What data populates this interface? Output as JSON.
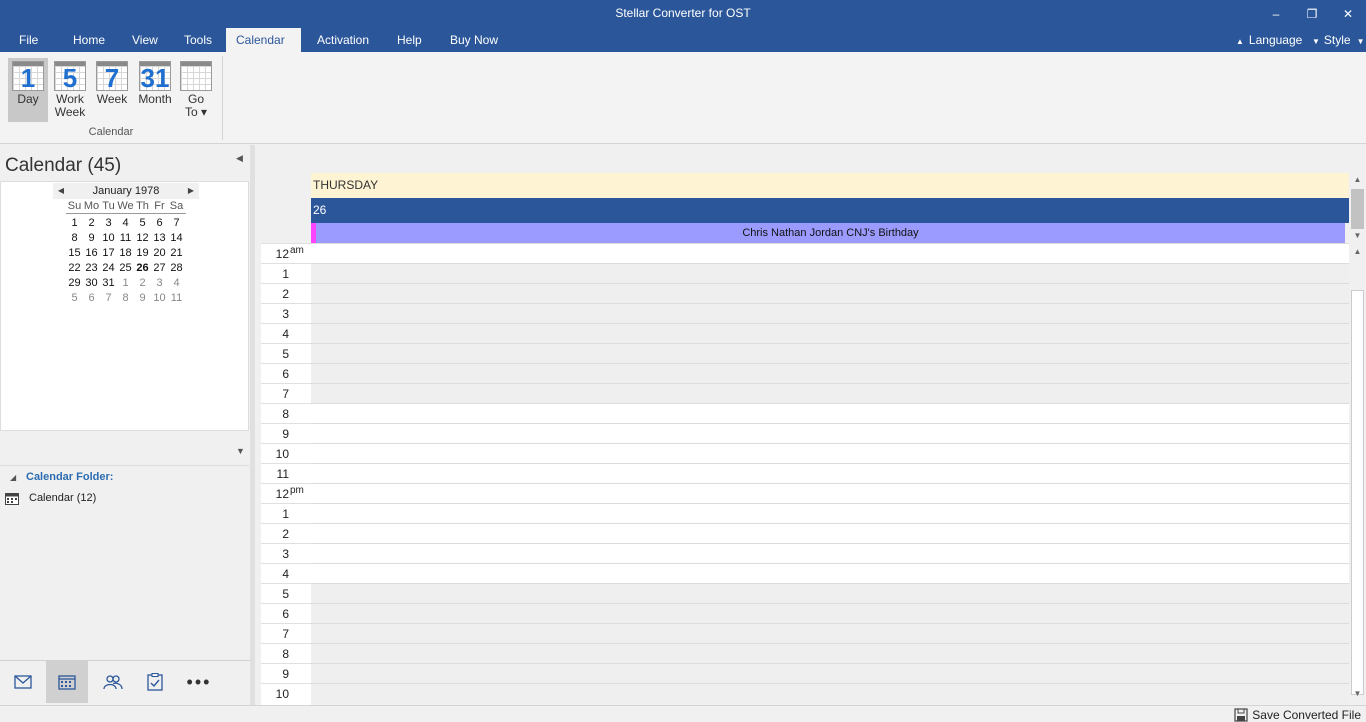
{
  "app": {
    "title": "Stellar Converter for OST"
  },
  "menu": {
    "items": [
      "File",
      "Home",
      "View",
      "Tools",
      "Calendar",
      "Activation",
      "Help",
      "Buy Now"
    ],
    "active": "Calendar",
    "language": "Language",
    "style": "Style"
  },
  "ribbon": {
    "buttons": [
      {
        "num": "1",
        "label": "Day"
      },
      {
        "num": "5",
        "label": "Work",
        "label2": "Week"
      },
      {
        "num": "7",
        "label": "Week"
      },
      {
        "num": "31",
        "label": "Month"
      },
      {
        "num": "",
        "label": "Go",
        "label2": "To ▾"
      }
    ],
    "group_label": "Calendar"
  },
  "left": {
    "title": "Calendar (45)",
    "minical": {
      "month": "January 1978",
      "days": [
        "Su",
        "Mo",
        "Tu",
        "We",
        "Th",
        "Fr",
        "Sa"
      ],
      "weeks": [
        [
          "1",
          "2",
          "3",
          "4",
          "5",
          "6",
          "7"
        ],
        [
          "8",
          "9",
          "10",
          "11",
          "12",
          "13",
          "14"
        ],
        [
          "15",
          "16",
          "17",
          "18",
          "19",
          "20",
          "21"
        ],
        [
          "22",
          "23",
          "24",
          "25",
          "26",
          "27",
          "28"
        ],
        [
          "29",
          "30",
          "31",
          "1",
          "2",
          "3",
          "4"
        ],
        [
          "5",
          "6",
          "7",
          "8",
          "9",
          "10",
          "11"
        ]
      ],
      "today": "26"
    },
    "folder_title": "Calendar Folder:",
    "folder_item": "Calendar (12)"
  },
  "day": {
    "weekday": "THURSDAY",
    "daynum": "26",
    "event": "Chris Nathan Jordan CNJ's Birthday",
    "hours": [
      {
        "h": "12",
        "ap": "am"
      },
      {
        "h": "1"
      },
      {
        "h": "2"
      },
      {
        "h": "3"
      },
      {
        "h": "4"
      },
      {
        "h": "5"
      },
      {
        "h": "6"
      },
      {
        "h": "7"
      },
      {
        "h": "8"
      },
      {
        "h": "9"
      },
      {
        "h": "10"
      },
      {
        "h": "11"
      },
      {
        "h": "12",
        "ap": "pm"
      },
      {
        "h": "1"
      },
      {
        "h": "2"
      },
      {
        "h": "3"
      },
      {
        "h": "4"
      },
      {
        "h": "5"
      },
      {
        "h": "6"
      },
      {
        "h": "7"
      },
      {
        "h": "8"
      },
      {
        "h": "9"
      },
      {
        "h": "10"
      }
    ]
  },
  "status": {
    "save": "Save Converted File"
  }
}
